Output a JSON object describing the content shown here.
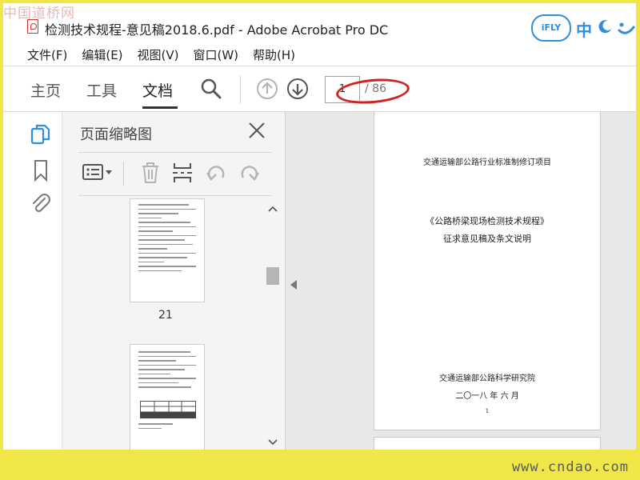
{
  "watermark": {
    "top": "中国道桥网",
    "bottom": "www.cndao.com"
  },
  "window": {
    "title": "检测技术规程-意见稿2018.6.pdf - Adobe Acrobat Pro DC"
  },
  "ifly": {
    "logo_text": "iFLY",
    "lang_label": "中"
  },
  "menu": [
    "文件(F)",
    "编辑(E)",
    "视图(V)",
    "窗口(W)",
    "帮助(H)"
  ],
  "tabs": {
    "home": "主页",
    "tools": "工具",
    "document": "文档"
  },
  "navigation": {
    "current_page": "1",
    "total_pages": "/ 86"
  },
  "thumbnails_panel": {
    "title": "页面缩略图",
    "thumbnails": [
      {
        "page_label": "21"
      }
    ]
  },
  "document": {
    "line1": "交通运输部公路行业标准制修订项目",
    "line2": "《公路桥梁现场检测技术规程》",
    "line3": "征求意见稿及条文说明",
    "line4": "交通运输部公路科学研究院",
    "line5": "二〇一八 年 六 月",
    "page_num": "1"
  },
  "colors": {
    "accent_blue": "#2e8ee0",
    "highlight_red": "#d42020",
    "frame_yellow": "#f0e648"
  }
}
